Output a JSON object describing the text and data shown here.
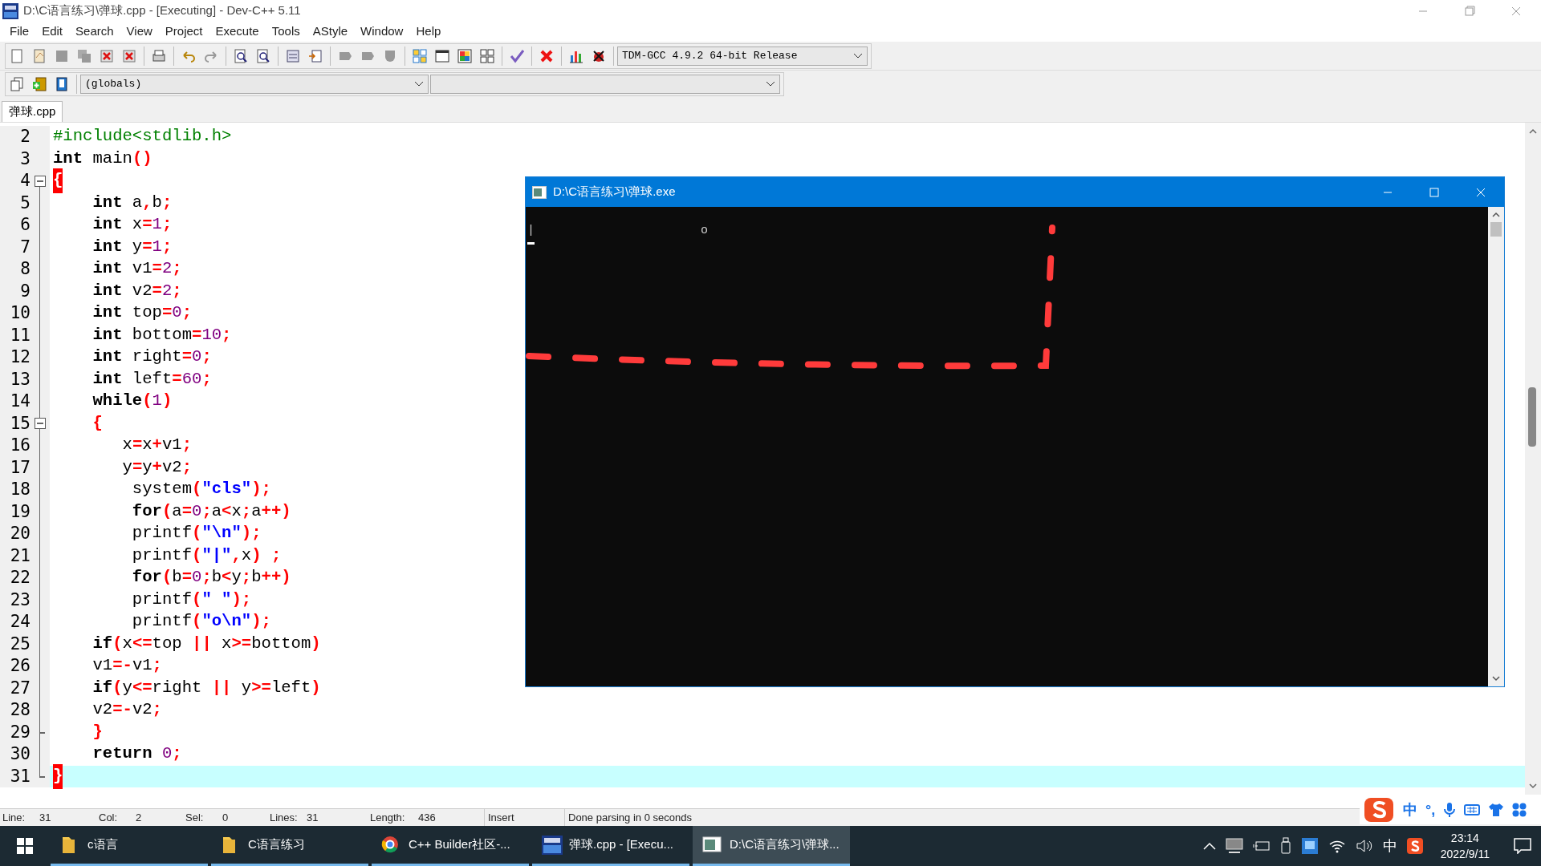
{
  "window": {
    "title": "D:\\C语言练习\\弹球.cpp - [Executing] - Dev-C++ 5.11"
  },
  "menu": [
    "File",
    "Edit",
    "Search",
    "View",
    "Project",
    "Execute",
    "Tools",
    "AStyle",
    "Window",
    "Help"
  ],
  "compiler_select": {
    "value": "TDM-GCC 4.9.2 64-bit Release"
  },
  "scope_select": {
    "value": "(globals)"
  },
  "tabs": [
    {
      "label": "弹球.cpp",
      "selected": true
    }
  ],
  "editor": {
    "lines": [
      {
        "n": "2",
        "tokens": [
          {
            "kind": "preprocessor",
            "text": "#include<stdlib.h>"
          }
        ]
      },
      {
        "n": "3",
        "tokens": [
          {
            "kind": "keyword",
            "text": "int"
          },
          {
            "kind": "identifier",
            "text": " main"
          },
          {
            "kind": "operator",
            "text": "()"
          }
        ]
      },
      {
        "n": "4",
        "fold_start": true,
        "tokens": [
          {
            "kind": "brace_match",
            "text": "{"
          }
        ]
      },
      {
        "n": "5",
        "tokens": [
          {
            "kind": "keyword",
            "text": "    int"
          },
          {
            "kind": "identifier",
            "text": " a"
          },
          {
            "kind": "operator",
            "text": ","
          },
          {
            "kind": "identifier",
            "text": "b"
          },
          {
            "kind": "operator",
            "text": ";"
          }
        ]
      },
      {
        "n": "6",
        "tokens": [
          {
            "kind": "keyword",
            "text": "    int"
          },
          {
            "kind": "identifier",
            "text": " x"
          },
          {
            "kind": "operator",
            "text": "="
          },
          {
            "kind": "number",
            "text": "1"
          },
          {
            "kind": "operator",
            "text": ";"
          }
        ]
      },
      {
        "n": "7",
        "tokens": [
          {
            "kind": "keyword",
            "text": "    int"
          },
          {
            "kind": "identifier",
            "text": " y"
          },
          {
            "kind": "operator",
            "text": "="
          },
          {
            "kind": "number",
            "text": "1"
          },
          {
            "kind": "operator",
            "text": ";"
          }
        ]
      },
      {
        "n": "8",
        "tokens": [
          {
            "kind": "keyword",
            "text": "    int"
          },
          {
            "kind": "identifier",
            "text": " v1"
          },
          {
            "kind": "operator",
            "text": "="
          },
          {
            "kind": "number",
            "text": "2"
          },
          {
            "kind": "operator",
            "text": ";"
          }
        ]
      },
      {
        "n": "9",
        "tokens": [
          {
            "kind": "keyword",
            "text": "    int"
          },
          {
            "kind": "identifier",
            "text": " v2"
          },
          {
            "kind": "operator",
            "text": "="
          },
          {
            "kind": "number",
            "text": "2"
          },
          {
            "kind": "operator",
            "text": ";"
          }
        ]
      },
      {
        "n": "10",
        "tokens": [
          {
            "kind": "keyword",
            "text": "    int"
          },
          {
            "kind": "identifier",
            "text": " top"
          },
          {
            "kind": "operator",
            "text": "="
          },
          {
            "kind": "number",
            "text": "0"
          },
          {
            "kind": "operator",
            "text": ";"
          }
        ]
      },
      {
        "n": "11",
        "tokens": [
          {
            "kind": "keyword",
            "text": "    int"
          },
          {
            "kind": "identifier",
            "text": " bottom"
          },
          {
            "kind": "operator",
            "text": "="
          },
          {
            "kind": "number",
            "text": "10"
          },
          {
            "kind": "operator",
            "text": ";"
          }
        ]
      },
      {
        "n": "12",
        "tokens": [
          {
            "kind": "keyword",
            "text": "    int"
          },
          {
            "kind": "identifier",
            "text": " right"
          },
          {
            "kind": "operator",
            "text": "="
          },
          {
            "kind": "number",
            "text": "0"
          },
          {
            "kind": "operator",
            "text": ";"
          }
        ]
      },
      {
        "n": "13",
        "tokens": [
          {
            "kind": "keyword",
            "text": "    int"
          },
          {
            "kind": "identifier",
            "text": " left"
          },
          {
            "kind": "operator",
            "text": "="
          },
          {
            "kind": "number",
            "text": "60"
          },
          {
            "kind": "operator",
            "text": ";"
          }
        ]
      },
      {
        "n": "14",
        "tokens": [
          {
            "kind": "keyword",
            "text": "    while"
          },
          {
            "kind": "operator",
            "text": "("
          },
          {
            "kind": "number",
            "text": "1"
          },
          {
            "kind": "operator",
            "text": ")"
          }
        ]
      },
      {
        "n": "15",
        "fold_start": true,
        "tokens": [
          {
            "kind": "operator",
            "text": "    {"
          }
        ]
      },
      {
        "n": "16",
        "tokens": [
          {
            "kind": "identifier",
            "text": "       x"
          },
          {
            "kind": "operator",
            "text": "="
          },
          {
            "kind": "identifier",
            "text": "x"
          },
          {
            "kind": "operator",
            "text": "+"
          },
          {
            "kind": "identifier",
            "text": "v1"
          },
          {
            "kind": "operator",
            "text": ";"
          }
        ]
      },
      {
        "n": "17",
        "tokens": [
          {
            "kind": "identifier",
            "text": "       y"
          },
          {
            "kind": "operator",
            "text": "="
          },
          {
            "kind": "identifier",
            "text": "y"
          },
          {
            "kind": "operator",
            "text": "+"
          },
          {
            "kind": "identifier",
            "text": "v2"
          },
          {
            "kind": "operator",
            "text": ";"
          }
        ]
      },
      {
        "n": "18",
        "tokens": [
          {
            "kind": "identifier",
            "text": "        system"
          },
          {
            "kind": "operator",
            "text": "("
          },
          {
            "kind": "string",
            "text": "\"cls\""
          },
          {
            "kind": "operator",
            "text": ");"
          }
        ]
      },
      {
        "n": "19",
        "tokens": [
          {
            "kind": "keyword",
            "text": "        for"
          },
          {
            "kind": "operator",
            "text": "("
          },
          {
            "kind": "identifier",
            "text": "a"
          },
          {
            "kind": "operator",
            "text": "="
          },
          {
            "kind": "number",
            "text": "0"
          },
          {
            "kind": "operator",
            "text": ";"
          },
          {
            "kind": "identifier",
            "text": "a"
          },
          {
            "kind": "operator",
            "text": "<"
          },
          {
            "kind": "identifier",
            "text": "x"
          },
          {
            "kind": "operator",
            "text": ";"
          },
          {
            "kind": "identifier",
            "text": "a"
          },
          {
            "kind": "operator",
            "text": "++)"
          }
        ]
      },
      {
        "n": "20",
        "tokens": [
          {
            "kind": "identifier",
            "text": "        printf"
          },
          {
            "kind": "operator",
            "text": "("
          },
          {
            "kind": "string",
            "text": "\"\\n\""
          },
          {
            "kind": "operator",
            "text": ");"
          }
        ]
      },
      {
        "n": "21",
        "tokens": [
          {
            "kind": "identifier",
            "text": "        printf"
          },
          {
            "kind": "operator",
            "text": "("
          },
          {
            "kind": "string",
            "text": "\"|\""
          },
          {
            "kind": "operator",
            "text": ","
          },
          {
            "kind": "identifier",
            "text": "x"
          },
          {
            "kind": "operator",
            "text": ") ;"
          }
        ]
      },
      {
        "n": "22",
        "tokens": [
          {
            "kind": "keyword",
            "text": "        for"
          },
          {
            "kind": "operator",
            "text": "("
          },
          {
            "kind": "identifier",
            "text": "b"
          },
          {
            "kind": "operator",
            "text": "="
          },
          {
            "kind": "number",
            "text": "0"
          },
          {
            "kind": "operator",
            "text": ";"
          },
          {
            "kind": "identifier",
            "text": "b"
          },
          {
            "kind": "operator",
            "text": "<"
          },
          {
            "kind": "identifier",
            "text": "y"
          },
          {
            "kind": "operator",
            "text": ";"
          },
          {
            "kind": "identifier",
            "text": "b"
          },
          {
            "kind": "operator",
            "text": "++)"
          }
        ]
      },
      {
        "n": "23",
        "tokens": [
          {
            "kind": "identifier",
            "text": "        printf"
          },
          {
            "kind": "operator",
            "text": "("
          },
          {
            "kind": "string",
            "text": "\" \""
          },
          {
            "kind": "operator",
            "text": ");"
          }
        ]
      },
      {
        "n": "24",
        "tokens": [
          {
            "kind": "identifier",
            "text": "        printf"
          },
          {
            "kind": "operator",
            "text": "("
          },
          {
            "kind": "string",
            "text": "\"o\\n\""
          },
          {
            "kind": "operator",
            "text": ");"
          }
        ]
      },
      {
        "n": "25",
        "tokens": [
          {
            "kind": "keyword",
            "text": "    if"
          },
          {
            "kind": "operator",
            "text": "("
          },
          {
            "kind": "identifier",
            "text": "x"
          },
          {
            "kind": "operator",
            "text": "<="
          },
          {
            "kind": "identifier",
            "text": "top "
          },
          {
            "kind": "operator",
            "text": "||"
          },
          {
            "kind": "identifier",
            "text": " x"
          },
          {
            "kind": "operator",
            "text": ">="
          },
          {
            "kind": "identifier",
            "text": "bottom"
          },
          {
            "kind": "operator",
            "text": ")"
          }
        ]
      },
      {
        "n": "26",
        "tokens": [
          {
            "kind": "identifier",
            "text": "    v1"
          },
          {
            "kind": "operator",
            "text": "=-"
          },
          {
            "kind": "identifier",
            "text": "v1"
          },
          {
            "kind": "operator",
            "text": ";"
          }
        ]
      },
      {
        "n": "27",
        "tokens": [
          {
            "kind": "keyword",
            "text": "    if"
          },
          {
            "kind": "operator",
            "text": "("
          },
          {
            "kind": "identifier",
            "text": "y"
          },
          {
            "kind": "operator",
            "text": "<="
          },
          {
            "kind": "identifier",
            "text": "right "
          },
          {
            "kind": "operator",
            "text": "||"
          },
          {
            "kind": "identifier",
            "text": " y"
          },
          {
            "kind": "operator",
            "text": ">="
          },
          {
            "kind": "identifier",
            "text": "left"
          },
          {
            "kind": "operator",
            "text": ")"
          }
        ]
      },
      {
        "n": "28",
        "tokens": [
          {
            "kind": "identifier",
            "text": "    v2"
          },
          {
            "kind": "operator",
            "text": "=-"
          },
          {
            "kind": "identifier",
            "text": "v2"
          },
          {
            "kind": "operator",
            "text": ";"
          }
        ]
      },
      {
        "n": "29",
        "fold_end": true,
        "tokens": [
          {
            "kind": "operator",
            "text": "    }"
          }
        ]
      },
      {
        "n": "30",
        "tokens": [
          {
            "kind": "keyword",
            "text": "    return"
          },
          {
            "kind": "number",
            "text": " 0"
          },
          {
            "kind": "operator",
            "text": ";"
          }
        ]
      },
      {
        "n": "31",
        "fold_end": true,
        "current": true,
        "tokens": [
          {
            "kind": "brace_match",
            "text": "}"
          }
        ]
      }
    ]
  },
  "status_bar": {
    "fields": [
      {
        "label": "Line:",
        "value": "31"
      },
      {
        "label": "Col:",
        "value": "2"
      },
      {
        "label": "Sel:",
        "value": "0"
      },
      {
        "label": "Lines:",
        "value": "31"
      },
      {
        "label": "Length:",
        "value": "436"
      }
    ],
    "mode": "Insert",
    "message": "Done parsing in 0 seconds"
  },
  "console": {
    "title": "D:\\C语言练习\\弹球.exe",
    "lines": [
      "|                       o"
    ]
  },
  "ime_bar": {
    "language": "中",
    "punctuation": "°,"
  },
  "taskbar": {
    "items": [
      {
        "kind": "folder",
        "label": "c语言",
        "selected": false
      },
      {
        "kind": "folder",
        "label": "C语言练习",
        "selected": false
      },
      {
        "kind": "browser",
        "label": "C++ Builder社区-...",
        "selected": false
      },
      {
        "kind": "ide",
        "label": "弹球.cpp - [Execu...",
        "selected": false
      },
      {
        "kind": "console",
        "label": "D:\\C语言练习\\弹球...",
        "selected": true
      }
    ],
    "tray_language": "中",
    "time": "23:14",
    "date": "2022/9/11"
  }
}
